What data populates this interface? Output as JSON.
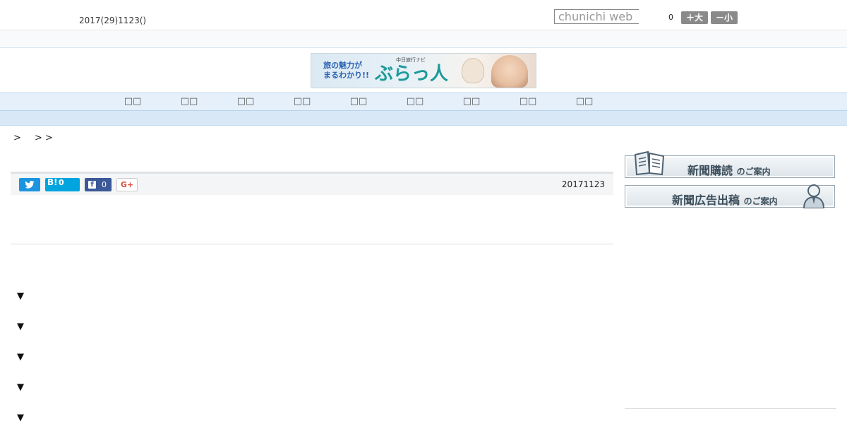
{
  "header": {
    "date": "2017(29)1123()",
    "search_placeholder": "chunichi web",
    "font_size_value": "0",
    "enlarge_label": "＋大",
    "shrink_label": "－小"
  },
  "banner": {
    "tagline": "旅の魅力が\nまるわかり!!",
    "sub": "中日旅行ナビ",
    "logo": "ぶらっ人"
  },
  "nav": {
    "items": [
      "",
      "",
      "",
      "",
      "",
      "",
      "",
      "",
      ""
    ]
  },
  "breadcrumb": {
    "sep1": ">",
    "sep2": "> >"
  },
  "share": {
    "hatena_label": "B!",
    "hatena_count": "0",
    "facebook_icon": "f",
    "facebook_count": "0",
    "google_label": "G+",
    "publish_date": "20171123"
  },
  "article": {
    "markers": [
      "▼",
      "▼",
      "▼",
      "▼",
      "▼"
    ]
  },
  "sidebar": {
    "subscribe_main": "新聞購読",
    "subscribe_suffix": "のご案内",
    "advertise_main": "新聞広告出稿",
    "advertise_suffix": "のご案内"
  }
}
